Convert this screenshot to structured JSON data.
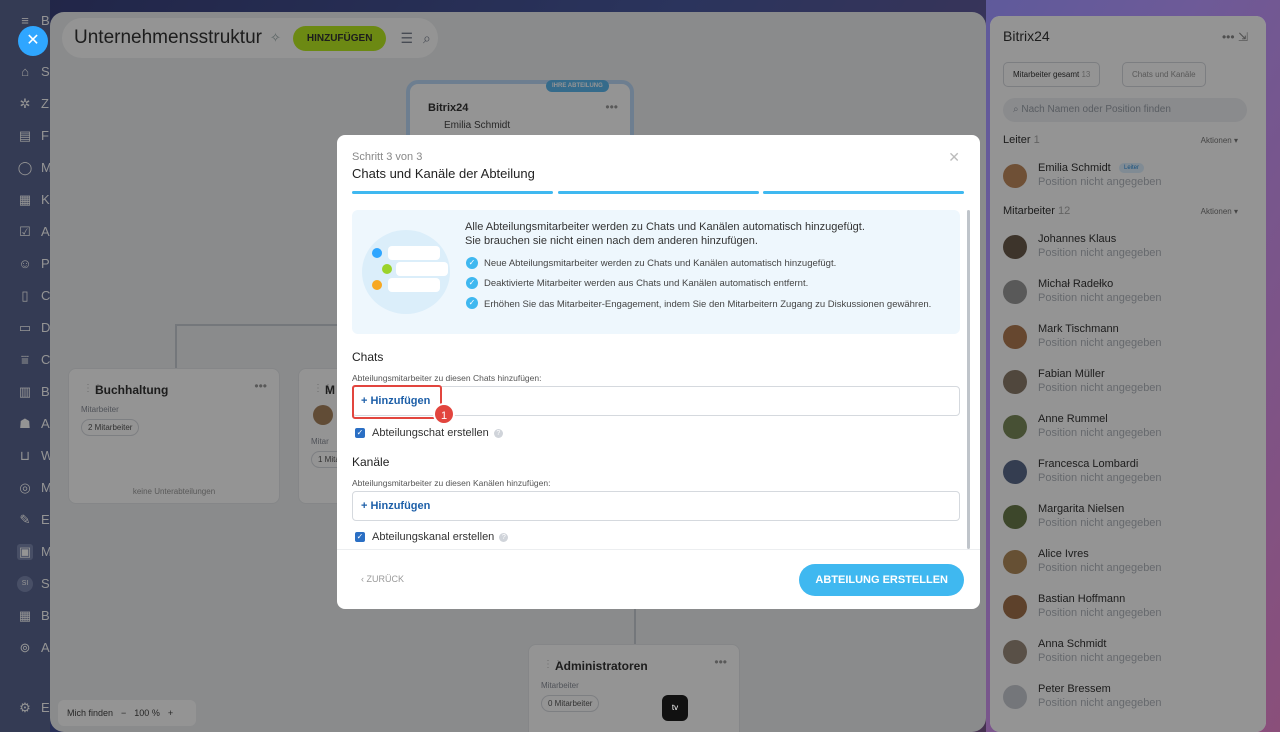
{
  "workspace": {
    "title": "Unternehmensstruktur",
    "add_button": "HINZUFÜGEN",
    "top_department": {
      "badge": "IHRE ABTEILUNG",
      "name": "Bitrix24",
      "leader": "Emilia Schmidt"
    },
    "buchhaltung": {
      "name": "Buchhaltung",
      "label": "Mitarbeiter",
      "count": "2 Mitarbeiter",
      "sub": "keine Unterabteilungen"
    },
    "second_card": {
      "name": "M",
      "label": "Mitar",
      "count": "1 Mita"
    },
    "administratoren": {
      "name": "Administratoren",
      "label": "Mitarbeiter",
      "count": "0 Mitarbeiter"
    },
    "find_me": "Mich finden",
    "zoom": "100 %",
    "zoom_minus": "−",
    "zoom_plus": "+",
    "appletv": "tv"
  },
  "leftnav": {
    "labels": [
      "B",
      "S",
      "Z",
      "F",
      "M",
      "K",
      "A",
      "P",
      "C",
      "D",
      "C",
      "B",
      "A",
      "W",
      "M",
      "E",
      "M",
      "S",
      "B",
      "A",
      "C",
      "E"
    ],
    "si_badge": "SI"
  },
  "modal": {
    "step": "Schritt 3 von 3",
    "title": "Chats und Kanäle der Abteilung",
    "intro_line1": "Alle Abteilungsmitarbeiter werden zu Chats und Kanälen automatisch hinzugefügt.",
    "intro_line2": "Sie brauchen sie nicht einen nach dem anderen hinzufügen.",
    "bullets": [
      "Neue Abteilungsmitarbeiter werden zu Chats und Kanälen automatisch hinzugefügt.",
      "Deaktivierte Mitarbeiter werden aus Chats und Kanälen automatisch entfernt.",
      "Erhöhen Sie das Mitarbeiter-Engagement, indem Sie den Mitarbeitern Zugang zu Diskussionen gewähren."
    ],
    "chats_heading": "Chats",
    "chats_hint": "Abteilungsmitarbeiter zu diesen Chats hinzufügen:",
    "add_label": "+ Hinzufügen",
    "chat_checkbox": "Abteilungschat erstellen",
    "channels_heading": "Kanäle",
    "channels_hint": "Abteilungsmitarbeiter zu diesen Kanälen hinzufügen:",
    "channel_checkbox": "Abteilungskanal erstellen",
    "back": "ZURÜCK",
    "create": "ABTEILUNG ERSTELLEN",
    "marker": "1"
  },
  "panel": {
    "title": "Bitrix24",
    "tab_employees": "Mitarbeiter gesamt",
    "tab_employees_count": "13",
    "tab_chats": "Chats und Kanäle",
    "search_placeholder": "Nach Namen oder Position finden",
    "leader_section": "Leiter",
    "leader_count": "1",
    "employees_section": "Mitarbeiter",
    "employees_count": "12",
    "actions": "Aktionen",
    "leader": {
      "name": "Emilia Schmidt",
      "badge": "Leiter",
      "position": "Position nicht angegeben"
    },
    "employees": [
      {
        "name": "Johannes Klaus",
        "position": "Position nicht angegeben"
      },
      {
        "name": "Michał Radełko",
        "position": "Position nicht angegeben"
      },
      {
        "name": "Mark Tischmann",
        "position": "Position nicht angegeben"
      },
      {
        "name": "Fabian Müller",
        "position": "Position nicht angegeben"
      },
      {
        "name": "Anne Rummel",
        "position": "Position nicht angegeben"
      },
      {
        "name": "Francesca Lombardi",
        "position": "Position nicht angegeben"
      },
      {
        "name": "Margarita Nielsen",
        "position": "Position nicht angegeben"
      },
      {
        "name": "Alice Ivres",
        "position": "Position nicht angegeben"
      },
      {
        "name": "Bastian Hoffmann",
        "position": "Position nicht angegeben"
      },
      {
        "name": "Anna Schmidt",
        "position": "Position nicht angegeben"
      },
      {
        "name": "Peter Bressem",
        "position": "Position nicht angegeben"
      }
    ]
  },
  "colors": {
    "accent": "#3fb8f0",
    "add_green": "#bbed21",
    "highlight": "#e2453e",
    "link": "#1d5fa8"
  }
}
